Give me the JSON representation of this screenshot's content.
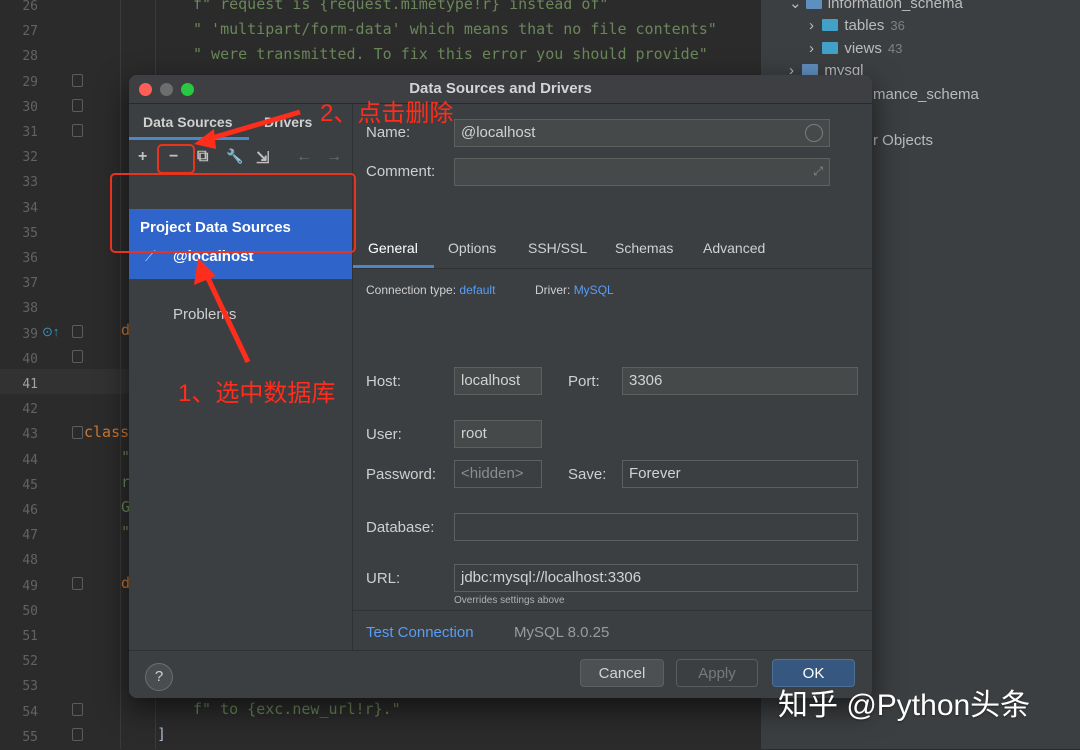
{
  "editor": {
    "line_numbers": [
      "26",
      "27",
      "28",
      "29",
      "30",
      "31",
      "32",
      "33",
      "34",
      "35",
      "36",
      "37",
      "38",
      "39",
      "40",
      "41",
      "42",
      "43",
      "44",
      "45",
      "46",
      "47",
      "48",
      "49",
      "50",
      "51",
      "52",
      "53",
      "54",
      "55"
    ],
    "code_line_1": "f\" request is {request.mimetype!r} instead of\"",
    "code_line_2": "\" 'multipart/form-data' which means that no file contents\"",
    "code_line_3": "\" were transmitted. To fix this error you should provide\"",
    "code_d1": "d",
    "code_class": "class",
    "code_q1": "\"",
    "code_r": "r",
    "code_g": "G",
    "code_q2": "\"",
    "code_d2": "d",
    "code_last": "f\" to {exc.new_url!r}.\"",
    "code_bracket": "]"
  },
  "db_tree": {
    "schema": "information_schema",
    "tables_label": "tables",
    "tables_count": "36",
    "views_label": "views",
    "views_count": "43",
    "mysql": "mysql",
    "perf_schema": "mance_schema",
    "objects": "r Objects"
  },
  "dialog": {
    "title": "Data Sources and Drivers",
    "left_tabs": {
      "data_sources": "Data Sources",
      "drivers": "Drivers"
    },
    "toolbar": {
      "add": "+",
      "remove": "−",
      "copy": "⧉",
      "settings": "🔧",
      "import": "⇲",
      "back": "←",
      "forward": "→"
    },
    "project_sources_label": "Project Data Sources",
    "selected_source": "@localhost",
    "problems_label": "Problems",
    "name_label": "Name:",
    "name_value": "@localhost",
    "comment_label": "Comment:",
    "tabs": [
      "General",
      "Options",
      "SSH/SSL",
      "Schemas",
      "Advanced"
    ],
    "connection_type_label": "Connection type:",
    "connection_type_value": "default",
    "driver_label": "Driver:",
    "driver_value": "MySQL",
    "host_label": "Host:",
    "host_value": "localhost",
    "port_label": "Port:",
    "port_value": "3306",
    "user_label": "User:",
    "user_value": "root",
    "password_label": "Password:",
    "password_placeholder": "<hidden>",
    "save_label": "Save:",
    "save_value": "Forever",
    "database_label": "Database:",
    "database_value": "",
    "url_label": "URL:",
    "url_value": "jdbc:mysql://localhost:3306",
    "url_hint": "Overrides settings above",
    "test_connection": "Test Connection",
    "server_version": "MySQL 8.0.25",
    "help": "?",
    "cancel": "Cancel",
    "apply": "Apply",
    "ok": "OK"
  },
  "annotations": {
    "step1": "1、选中数据库",
    "step2": "2、点击删除",
    "color": "#ff2d1c"
  },
  "watermark": "知乎 @Python头条",
  "colors": {
    "selection": "#2f65ca",
    "accent": "#4a88c7",
    "ok_button": "#365880",
    "link": "#589df6"
  }
}
